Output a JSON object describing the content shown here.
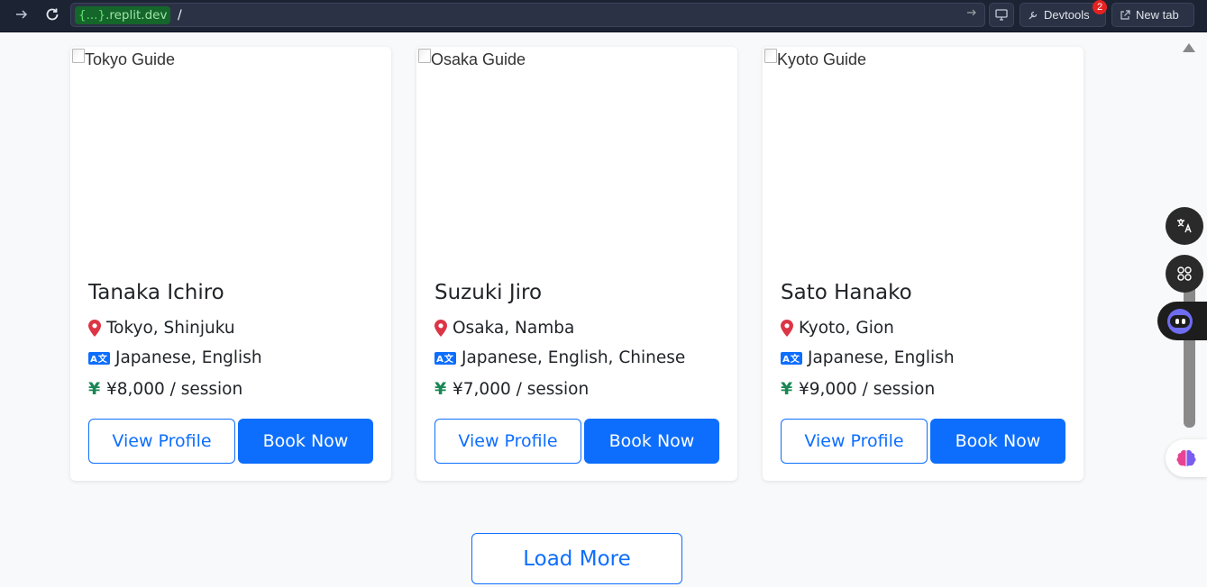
{
  "browser": {
    "url_domain_tag": "{...}",
    "url_domain_rest": ".replit.dev",
    "url_path": "/",
    "devtools_label": "Devtools",
    "devtools_badge": "2",
    "new_tab_label": "New tab"
  },
  "guides": [
    {
      "image_alt": "Tokyo Guide",
      "name": "Tanaka Ichiro",
      "location": "Tokyo, Shinjuku",
      "languages": "Japanese, English",
      "price": "¥8,000 / session",
      "view_label": "View Profile",
      "book_label": "Book Now"
    },
    {
      "image_alt": "Osaka Guide",
      "name": "Suzuki Jiro",
      "location": "Osaka, Namba",
      "languages": "Japanese, English, Chinese",
      "price": "¥7,000 / session",
      "view_label": "View Profile",
      "book_label": "Book Now"
    },
    {
      "image_alt": "Kyoto Guide",
      "name": "Sato Hanako",
      "location": "Kyoto, Gion",
      "languages": "Japanese, English",
      "price": "¥9,000 / session",
      "view_label": "View Profile",
      "book_label": "Book Now"
    }
  ],
  "load_more_label": "Load More",
  "colors": {
    "primary": "#0d6efd",
    "location_pin": "#dc3545",
    "price_icon": "#198754"
  },
  "icons": {
    "location": "map-pin-icon",
    "language": "translate-icon",
    "price": "yen-icon"
  }
}
